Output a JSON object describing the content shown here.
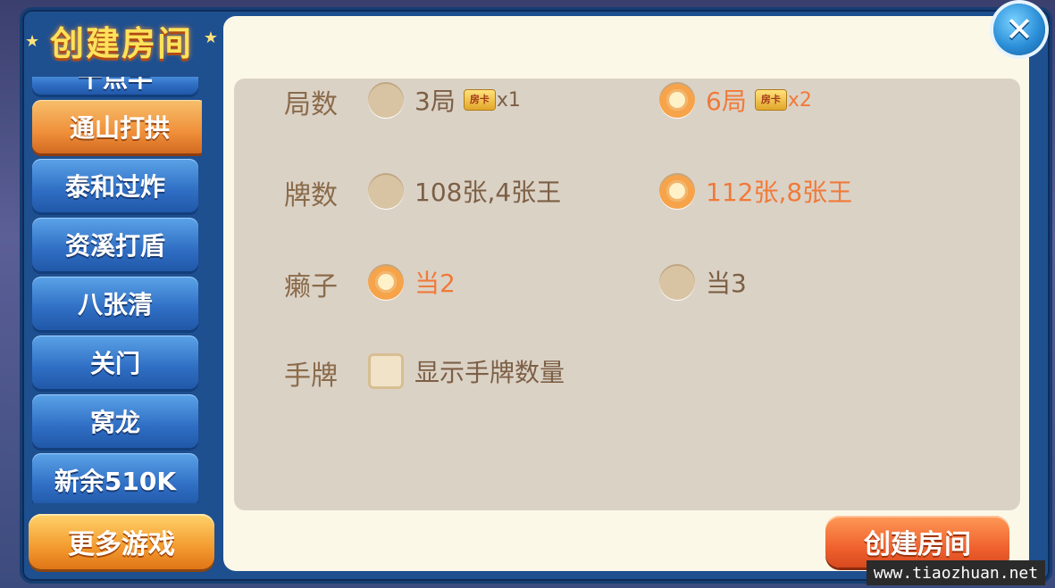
{
  "title": "创建房间",
  "sidebar": {
    "items": [
      {
        "label": "十点半",
        "state": "partial"
      },
      {
        "label": "通山打拱",
        "state": "active"
      },
      {
        "label": "泰和过炸",
        "state": "normal"
      },
      {
        "label": "资溪打盾",
        "state": "normal"
      },
      {
        "label": "八张清",
        "state": "normal"
      },
      {
        "label": "关门",
        "state": "normal"
      },
      {
        "label": "窝龙",
        "state": "normal"
      },
      {
        "label": "新余510K",
        "state": "partial"
      }
    ],
    "more_games": "更多游戏"
  },
  "options": {
    "rounds": {
      "label": "局数",
      "choices": [
        {
          "text": "3局",
          "card_icon": "房卡",
          "mult": "x1",
          "selected": false
        },
        {
          "text": "6局",
          "card_icon": "房卡",
          "mult": "x2",
          "selected": true
        }
      ]
    },
    "cards": {
      "label": "牌数",
      "choices": [
        {
          "text": "108张,4张王",
          "selected": false
        },
        {
          "text": "112张,8张王",
          "selected": true
        }
      ]
    },
    "wild": {
      "label": "癞子",
      "choices": [
        {
          "text": "当2",
          "selected": true
        },
        {
          "text": "当3",
          "selected": false
        }
      ]
    },
    "hand": {
      "label": "手牌",
      "checkbox": {
        "text": "显示手牌数量",
        "checked": false
      }
    }
  },
  "create_button": "创建房间",
  "close_icon": "close-icon",
  "watermark": "www.tiaozhuan.net",
  "colors": {
    "accent_orange": "#f07a3a",
    "text_brown": "#7c5f45",
    "panel_bg": "#fcf8e7",
    "sidebar_blue": "#2f6ec4"
  }
}
